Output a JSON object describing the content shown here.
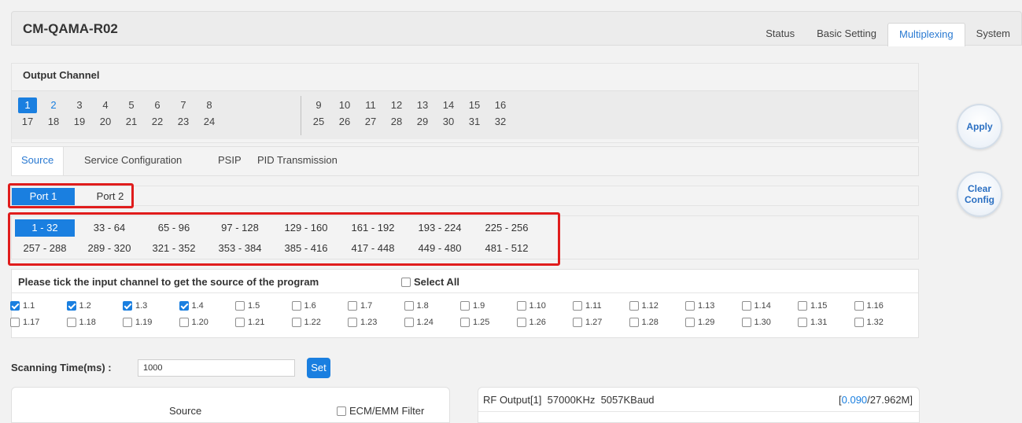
{
  "app": {
    "title": "CM-QAMA-R02"
  },
  "nav": [
    {
      "label": "Status",
      "active": false
    },
    {
      "label": "Basic Setting",
      "active": false
    },
    {
      "label": "Multiplexing",
      "active": true
    },
    {
      "label": "System",
      "active": false
    }
  ],
  "output_channel": {
    "title": "Output Channel",
    "row1": [
      "1",
      "2",
      "3",
      "4",
      "5",
      "6",
      "7",
      "8",
      "9",
      "10",
      "11",
      "12",
      "13",
      "14",
      "15",
      "16"
    ],
    "row2": [
      "17",
      "18",
      "19",
      "20",
      "21",
      "22",
      "23",
      "24",
      "25",
      "26",
      "27",
      "28",
      "29",
      "30",
      "31",
      "32"
    ],
    "selected": "1",
    "highlighted": "2"
  },
  "subtabs": [
    {
      "label": "Source",
      "active": true
    },
    {
      "label": "Service Configuration",
      "active": false
    },
    {
      "label": "PSIP",
      "active": false
    },
    {
      "label": "PID Transmission",
      "active": false
    }
  ],
  "ports": [
    {
      "label": "Port 1",
      "active": true
    },
    {
      "label": "Port 2",
      "active": false
    }
  ],
  "ranges": {
    "row1": [
      "1 - 32",
      "33 - 64",
      "65 - 96",
      "97 - 128",
      "129 - 160",
      "161 - 192",
      "193 - 224",
      "225 - 256"
    ],
    "row2": [
      "257 - 288",
      "289 - 320",
      "321 - 352",
      "353 - 384",
      "385 - 416",
      "417 - 448",
      "449 - 480",
      "481 - 512"
    ],
    "active": "1 - 32"
  },
  "input_channels": {
    "instruction": "Please tick the input channel to get the source of the program",
    "select_all_label": "Select All",
    "row1": [
      "1.1",
      "1.2",
      "1.3",
      "1.4",
      "1.5",
      "1.6",
      "1.7",
      "1.8",
      "1.9",
      "1.10",
      "1.11",
      "1.12",
      "1.13",
      "1.14",
      "1.15",
      "1.16"
    ],
    "row2": [
      "1.17",
      "1.18",
      "1.19",
      "1.20",
      "1.21",
      "1.22",
      "1.23",
      "1.24",
      "1.25",
      "1.26",
      "1.27",
      "1.28",
      "1.29",
      "1.30",
      "1.31",
      "1.32"
    ],
    "checked": [
      "1.1",
      "1.2",
      "1.3",
      "1.4"
    ]
  },
  "scanning": {
    "label": "Scanning Time(ms) :",
    "value": "1000",
    "set_label": "Set"
  },
  "source_panel": {
    "title": "Source",
    "ecm_label": "ECM/EMM Filter"
  },
  "rf_panel": {
    "title": "RF Output[1]  57000KHz  5057KBaud",
    "rate_open": "[",
    "rate_used": "0.090",
    "rate_rest": "/27.962M]"
  },
  "actions": {
    "apply_label": "Apply",
    "clear_label_1": "Clear",
    "clear_label_2": "Config"
  },
  "colors": {
    "accent": "#1a7fe0",
    "highlight_box": "#e01c1c"
  }
}
